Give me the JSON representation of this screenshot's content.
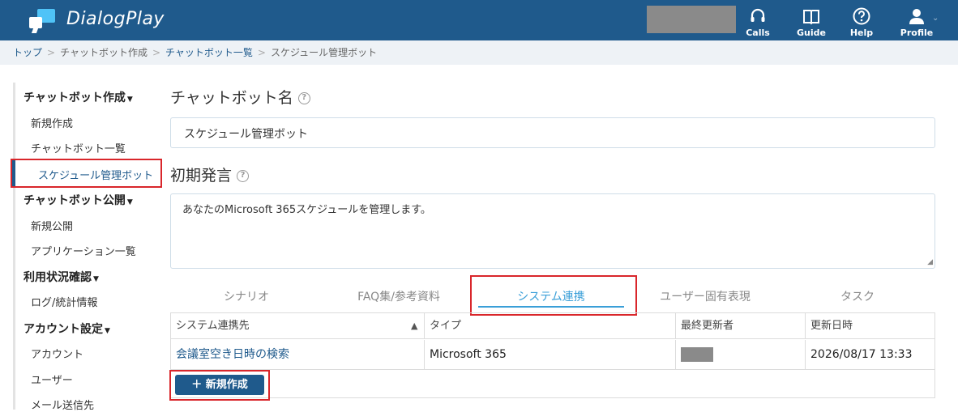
{
  "header": {
    "app_name": "DialogPlay",
    "nav": [
      {
        "label": "Calls",
        "icon": "headset-icon"
      },
      {
        "label": "Guide",
        "icon": "book-icon"
      },
      {
        "label": "Help",
        "icon": "help-icon"
      },
      {
        "label": "Profile",
        "icon": "user-icon"
      }
    ]
  },
  "breadcrumb": [
    "トップ",
    "チャットボット作成",
    "チャットボット一覧",
    "スケジュール管理ボット"
  ],
  "sidebar": {
    "sections": [
      {
        "title": "チャットボット作成",
        "items": [
          "新規作成",
          "チャットボット一覧",
          "スケジュール管理ボット"
        ]
      },
      {
        "title": "チャットボット公開",
        "items": [
          "新規公開",
          "アプリケーション一覧"
        ]
      },
      {
        "title": "利用状況確認",
        "items": [
          "ログ/統計情報"
        ]
      },
      {
        "title": "アカウント設定",
        "items": [
          "アカウント",
          "ユーザー",
          "メール送信先"
        ]
      }
    ]
  },
  "main": {
    "name_label": "チャットボット名",
    "name_value": "スケジュール管理ボット",
    "greeting_label": "初期発言",
    "greeting_value": "あなたのMicrosoft 365スケジュールを管理します。",
    "tabs": [
      "シナリオ",
      "FAQ集/参考資料",
      "システム連携",
      "ユーザー固有表現",
      "タスク"
    ],
    "active_tab": "システム連携",
    "table": {
      "headers": [
        "システム連携先",
        "タイプ",
        "最終更新者",
        "更新日時"
      ],
      "rows": [
        {
          "name": "会議室空き日時の検索",
          "type": "Microsoft 365",
          "updated_at": "2026/08/17 13:33"
        }
      ]
    },
    "new_button": "新規作成"
  },
  "colors": {
    "header": "#1f5a8c",
    "accent": "#3a9fd8",
    "highlight": "#d9262b"
  }
}
